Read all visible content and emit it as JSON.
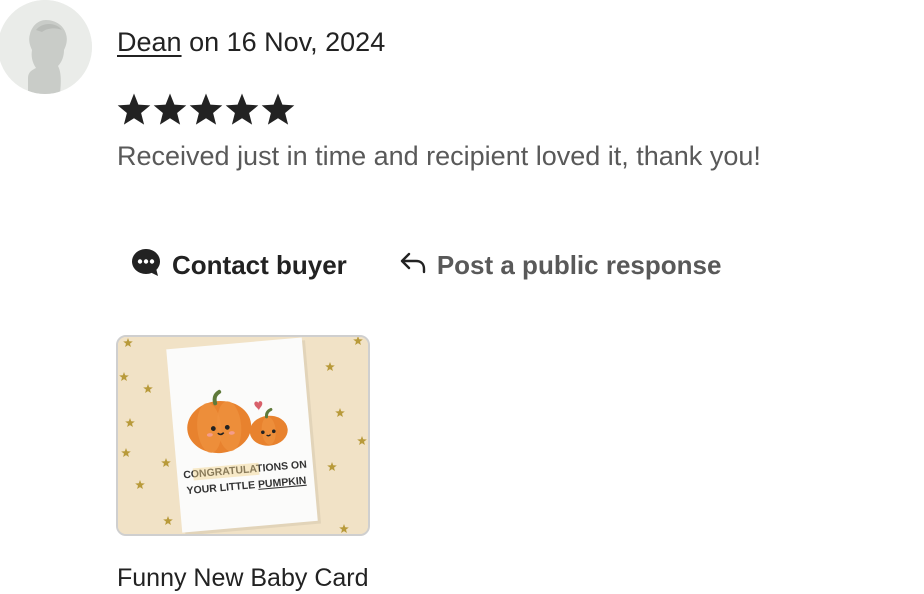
{
  "review": {
    "reviewer_name": "Dean",
    "date_text": "on 16 Nov, 2024",
    "rating": 5,
    "rating_max": 5,
    "text": "Received just in time and recipient loved it, thank you!"
  },
  "actions": {
    "contact_label": "Contact buyer",
    "respond_label": "Post a public response"
  },
  "listing": {
    "title": "Funny New Baby Card",
    "card_line1": "CONGRATULATIONS ON",
    "card_line2_a": "YOUR LITTLE ",
    "card_line2_b": "PUMPKIN"
  },
  "icons": {
    "avatar": "user-silhouette-icon",
    "star": "star-icon",
    "contact": "speech-bubble-icon",
    "respond": "reply-arrow-icon"
  },
  "colors": {
    "text_primary": "#222222",
    "text_secondary": "#595959",
    "thumb_background": "#f1e2c6",
    "pumpkin": "#e8822e",
    "star_gold": "#b89a3a"
  }
}
